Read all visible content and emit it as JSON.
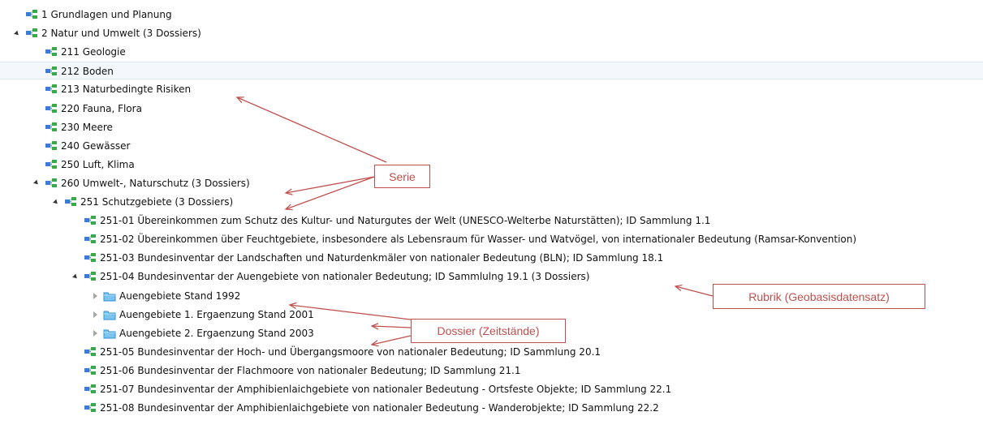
{
  "tree": {
    "rows": [
      {
        "label": "1 Grundlagen und Planung",
        "level": 0,
        "toggle": "none",
        "icon": "series-icon"
      },
      {
        "label": "2 Natur und Umwelt (3 Dossiers)",
        "level": 0,
        "toggle": "expanded",
        "icon": "series-icon"
      },
      {
        "label": "211 Geologie",
        "level": 1,
        "toggle": "none",
        "icon": "series-icon"
      },
      {
        "label": "212 Boden",
        "level": 1,
        "toggle": "none",
        "icon": "series-icon",
        "selected": true
      },
      {
        "label": "213 Naturbedingte Risiken",
        "level": 1,
        "toggle": "none",
        "icon": "series-icon"
      },
      {
        "label": "220 Fauna, Flora",
        "level": 1,
        "toggle": "none",
        "icon": "series-icon"
      },
      {
        "label": "230 Meere",
        "level": 1,
        "toggle": "none",
        "icon": "series-icon"
      },
      {
        "label": "240 Gewässer",
        "level": 1,
        "toggle": "none",
        "icon": "series-icon"
      },
      {
        "label": "250 Luft, Klima",
        "level": 1,
        "toggle": "none",
        "icon": "series-icon"
      },
      {
        "label": "260 Umwelt-, Naturschutz (3 Dossiers)",
        "level": 1,
        "toggle": "expanded",
        "icon": "series-icon"
      },
      {
        "label": "251 Schutzgebiete (3 Dossiers)",
        "level": 2,
        "toggle": "expanded",
        "icon": "series-icon"
      },
      {
        "label": "251-01 Übereinkommen zum Schutz des Kultur- und Naturgutes der Welt (UNESCO-Welterbe Naturstätten); ID Sammlung 1.1",
        "level": 3,
        "toggle": "none",
        "icon": "series-icon"
      },
      {
        "label": "251-02 Übereinkommen über Feuchtgebiete, insbesondere als Lebensraum für Wasser- und Watvögel, von internationaler Bedeutung (Ramsar-Konvention)",
        "level": 3,
        "toggle": "none",
        "icon": "series-icon"
      },
      {
        "label": "251-03 Bundesinventar der Landschaften und Naturdenkmäler von nationaler Bedeutung (BLN); ID Sammlung 18.1",
        "level": 3,
        "toggle": "none",
        "icon": "series-icon"
      },
      {
        "label": "251-04 Bundesinventar der Auengebiete von nationaler Bedeutung; ID Sammlulng 19.1 (3 Dossiers)",
        "level": 3,
        "toggle": "expanded",
        "icon": "series-icon"
      },
      {
        "label": "Auengebiete Stand 1992",
        "level": 4,
        "toggle": "collapsed",
        "icon": "folder-icon"
      },
      {
        "label": "Auengebiete 1. Ergaenzung Stand 2001",
        "level": 4,
        "toggle": "collapsed",
        "icon": "folder-icon"
      },
      {
        "label": "Auengebiete 2. Ergaenzung Stand 2003",
        "level": 4,
        "toggle": "collapsed",
        "icon": "folder-icon"
      },
      {
        "label": "251-05 Bundesinventar der Hoch- und Übergangsmoore von nationaler Bedeutung; ID Sammlung 20.1",
        "level": 3,
        "toggle": "none",
        "icon": "series-icon"
      },
      {
        "label": "251-06 Bundesinventar der Flachmoore von nationaler Bedeutung; ID Sammlung 21.1",
        "level": 3,
        "toggle": "none",
        "icon": "series-icon"
      },
      {
        "label": "251-07 Bundesinventar der Amphibienlaichgebiete von nationaler Bedeutung - Ortsfeste Objekte; ID Sammlung 22.1",
        "level": 3,
        "toggle": "none",
        "icon": "series-icon"
      },
      {
        "label": "251-08 Bundesinventar der Amphibienlaichgebiete von nationaler Bedeutung - Wanderobjekte; ID Sammlung 22.2",
        "level": 3,
        "toggle": "none",
        "icon": "series-icon"
      }
    ]
  },
  "annotations": {
    "serie": "Serie",
    "rubrik": "Rubrik (Geobasisdatensatz)",
    "dossier": "Dossier (Zeitstände)"
  },
  "colors": {
    "annotation": "#c0504d",
    "selection": "#f4f8fc",
    "series_icon_blue": "#3b7bd6",
    "series_icon_green": "#3aa84a",
    "folder_icon": "#5fb3ea"
  }
}
